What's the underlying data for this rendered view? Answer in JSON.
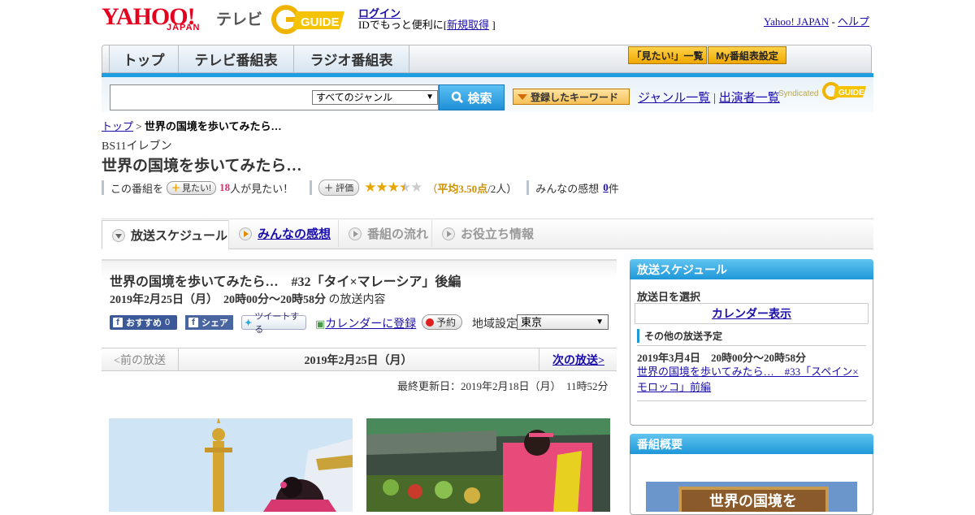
{
  "header": {
    "logo_text": "YAHOO!",
    "logo_sub": "JAPAN",
    "logo_tv": "テレビ",
    "login": "ログイン",
    "id_text": "IDでもっと便利に[",
    "register": "新規取得",
    "id_text_end": "]",
    "yahoo_japan": "Yahoo! JAPAN",
    "sep": "-",
    "help": "ヘルプ"
  },
  "nav": {
    "tabs": [
      "トップ",
      "テレビ番組表",
      "ラジオ番組表"
    ],
    "mitai_list": "「見たい!」一覧",
    "my_bangumi": "My番組表設定"
  },
  "search": {
    "genre_value": "すべてのジャンル",
    "button": "検索",
    "keyword_btn": "登録したキーワード",
    "genre_list": "ジャンル一覧",
    "divider": "|",
    "cast_list": "出演者一覧",
    "syndicated": "Syndicated"
  },
  "breadcrumb": {
    "top": "トップ",
    "sep": ">",
    "current": "世界の国境を歩いてみたら…"
  },
  "program": {
    "station": "BS11イレブン",
    "title": "世界の国境を歩いてみたら…",
    "want_prefix": "この番組を",
    "want_btn": "見たい!",
    "want_count": "18",
    "want_suffix": "人が見たい！",
    "rate_btn": "評価",
    "rating": 3.5,
    "avg_open": "（",
    "avg_label": "平均",
    "avg_value": "3.50点",
    "avg_people": "/2人）",
    "impressions_label": "みんなの感想",
    "impressions_count": "0",
    "impressions_unit": "件"
  },
  "tabs": [
    "放送スケジュール",
    "みんなの感想",
    "番組の流れ",
    "お役立ち情報"
  ],
  "episode": {
    "title": "世界の国境を歩いてみたら…　#32「タイ×マレーシア」後編",
    "datetime": "2019年2月25日（月）　20時00分～20時58分",
    "datetime_suffix": "の放送内容",
    "fb_recommend": "おすすめ",
    "fb_count": "0",
    "fb_share": "シェア",
    "tweet": "ツイートする",
    "calendar": "カレンダーに登録",
    "reserve": "予約",
    "region_label": "地域設定",
    "region_value": "東京"
  },
  "pager": {
    "prev": "<前の放送",
    "date": "2019年2月25日（月）",
    "next": "次の放送>"
  },
  "updated": "最終更新日：2019年2月18日（月）　11時52分",
  "sidebar": {
    "schedule_header": "放送スケジュール",
    "choose_date": "放送日を選択",
    "calendar_show": "カレンダー表示",
    "other_header": "その他の放送予定",
    "other_date": "2019年3月4日　20時00分～20時58分",
    "other_title": "世界の国境を歩いてみたら…　#33「スペイン×モロッコ」前編",
    "overview_header": "番組概要",
    "overview_img_text": "世界の国境を"
  },
  "colors": {
    "accent_blue": "#1e9ee0",
    "logo_red": "#e60020",
    "want_pink": "#e0306a",
    "star": "#e8a400"
  }
}
